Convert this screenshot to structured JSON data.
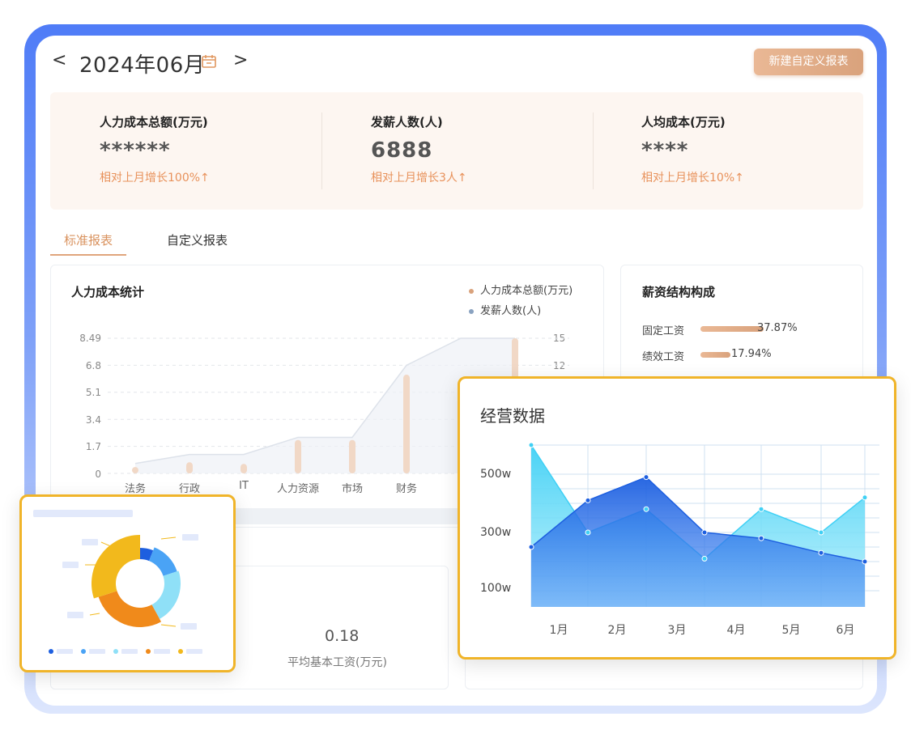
{
  "header": {
    "prev": "<",
    "date": "2024年06月",
    "next": ">",
    "new_report": "新建自定义报表"
  },
  "stats": [
    {
      "label": "人力成本总额(万元)",
      "value": "******",
      "change": "相对上月增长100%↑"
    },
    {
      "label": "发薪人数(人)",
      "value": "6888",
      "change": "相对上月增长3人↑"
    },
    {
      "label": "人均成本(万元)",
      "value": "****",
      "change": "相对上月增长10%↑"
    }
  ],
  "tabs": [
    {
      "label": "标准报表",
      "active": true
    },
    {
      "label": "自定义报表",
      "active": false
    }
  ],
  "cost_chart": {
    "title": "人力成本统计",
    "legend": [
      {
        "name": "人力成本总额(万元)",
        "color": "#d9a27c"
      },
      {
        "name": "发薪人数(人)",
        "color": "#8aa2c0"
      }
    ],
    "left_ticks": [
      "8.49",
      "6.8",
      "5.1",
      "3.4",
      "1.7",
      "0"
    ],
    "right_ticks": [
      "15",
      "12"
    ],
    "chart_data": {
      "type": "bar",
      "categories": [
        "法务",
        "行政",
        "IT",
        "人力资源",
        "市场",
        "财务"
      ],
      "series": [
        {
          "name": "人力成本总额(万元)",
          "values": [
            0.4,
            0.7,
            0.6,
            2.1,
            2.1,
            6.2
          ]
        },
        {
          "name": "发薪人数(人)",
          "values": [
            1.1,
            2.1,
            2.1,
            4,
            4,
            12
          ]
        }
      ],
      "ylim": [
        0,
        8.49
      ],
      "y2lim": [
        0,
        15
      ]
    }
  },
  "salary_structure": {
    "title": "薪资结构构成",
    "items": [
      {
        "label": "固定工资",
        "value": "37.87%",
        "ratio": 0.3787
      },
      {
        "label": "绩效工资",
        "value": "17.94%",
        "ratio": 0.1794
      }
    ]
  },
  "bottom_stat": {
    "value": "0.18",
    "label": "平均基本工资(万元)"
  },
  "donut": {
    "colors": [
      "#1d5fe0",
      "#4aa3f5",
      "#8fe0f7",
      "#f08a1b",
      "#f2b91c"
    ],
    "chart_data": {
      "type": "pie",
      "values": [
        6,
        14,
        22,
        28,
        30
      ]
    }
  },
  "ops_chart": {
    "title": "经营数据",
    "y_ticks": [
      "500w",
      "300w",
      "100w"
    ],
    "chart_data": {
      "type": "area",
      "x": [
        "1月",
        "2月",
        "3月",
        "4月",
        "5月",
        "6月"
      ],
      "series": [
        {
          "values": [
            600,
            300,
            380,
            210,
            380,
            300,
            420
          ],
          "color": "#5ad8f7"
        },
        {
          "values": [
            250,
            410,
            490,
            300,
            280,
            230,
            200
          ],
          "color": "#1d5fe0"
        }
      ],
      "ylim": [
        100,
        500
      ]
    }
  }
}
